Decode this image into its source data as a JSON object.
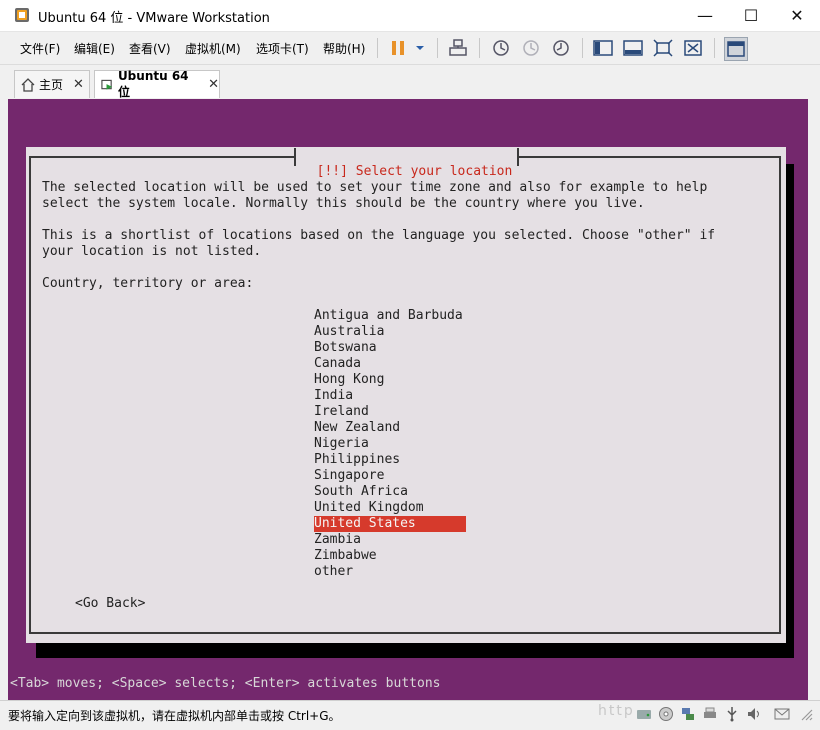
{
  "window": {
    "title": "Ubuntu 64 位 - VMware Workstation",
    "minimize_glyph": "—",
    "maximize_glyph": "☐",
    "close_glyph": "✕"
  },
  "menu": {
    "items": [
      "文件(F)",
      "编辑(E)",
      "查看(V)",
      "虚拟机(M)",
      "选项卡(T)",
      "帮助(H)"
    ]
  },
  "tabs": [
    {
      "label": "主页",
      "close": "✕"
    },
    {
      "label": "Ubuntu 64 位",
      "close": "✕"
    }
  ],
  "installer": {
    "dialog_title": "[!!] Select your location",
    "description_1": "The selected location will be used to set your time zone and also for example to help\nselect the system locale. Normally this should be the country where you live.",
    "description_2": "This is a shortlist of locations based on the language you selected. Choose \"other\" if\nyour location is not listed.",
    "prompt": "Country, territory or area:",
    "countries": [
      "Antigua and Barbuda",
      "Australia",
      "Botswana",
      "Canada",
      "Hong Kong",
      "India",
      "Ireland",
      "New Zealand",
      "Nigeria",
      "Philippines",
      "Singapore",
      "South Africa",
      "United Kingdom",
      "United States",
      "Zambia",
      "Zimbabwe",
      "other"
    ],
    "selected_index": 13,
    "go_back": "<Go Back>",
    "hint": "<Tab> moves; <Space> selects; <Enter> activates buttons"
  },
  "statusbar": {
    "text": "要将输入定向到该虚拟机，请在虚拟机内部单击或按 Ctrl+G。",
    "watermark": "http"
  },
  "colors": {
    "vm_background": "#74286d",
    "dialog_background": "#e5e0e4",
    "selection": "#d63a2c",
    "title_text": "#c8281c",
    "pause_icon": "#e8922a"
  }
}
